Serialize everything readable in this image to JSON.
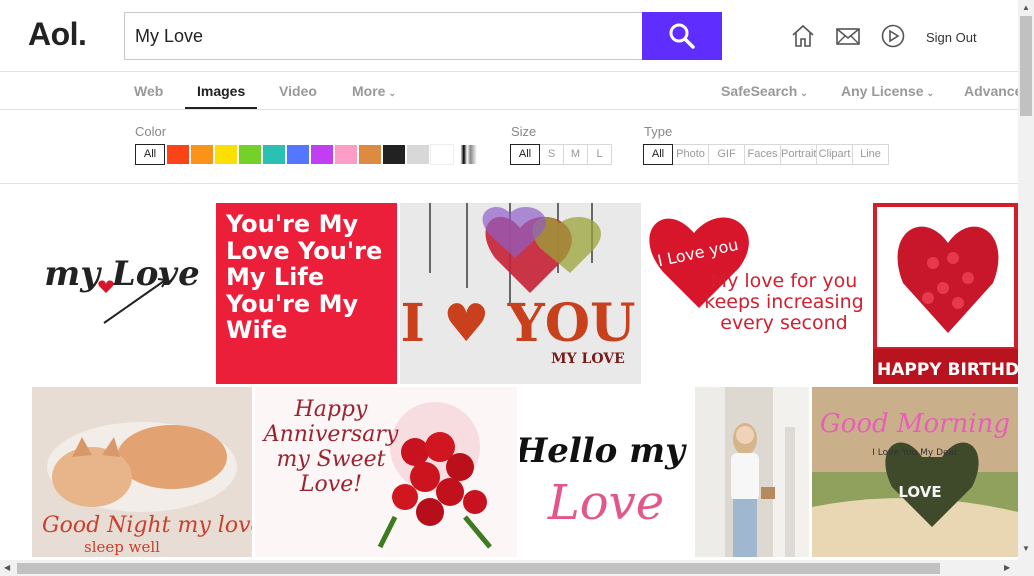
{
  "header": {
    "logo": "Aol.",
    "search_value": "My Love",
    "sign_out": "Sign Out",
    "icons": [
      "home-icon",
      "mail-icon",
      "play-icon"
    ]
  },
  "nav": {
    "tabs": [
      {
        "label": "Web",
        "active": false
      },
      {
        "label": "Images",
        "active": true
      },
      {
        "label": "Video",
        "active": false
      },
      {
        "label": "More",
        "active": false
      }
    ],
    "right": [
      {
        "label": "SafeSearch"
      },
      {
        "label": "Any License"
      },
      {
        "label": "Advanced"
      }
    ]
  },
  "filters": {
    "color_label": "Color",
    "color_all": "All",
    "colors": [
      "#fb4318",
      "#fb9319",
      "#f9e000",
      "#74d12a",
      "#2bc1b2",
      "#5577ff",
      "#c23ef3",
      "#fb9dc4",
      "#dd8b40",
      "#222222",
      "#d8d8d8",
      "#ffffff"
    ],
    "size_label": "Size",
    "sizes": [
      "All",
      "S",
      "M",
      "L"
    ],
    "type_label": "Type",
    "types": [
      "All",
      "Photo",
      "GIF",
      "Faces",
      "Portrait",
      "Clipart",
      "Line"
    ]
  },
  "results": {
    "row1": [
      {
        "text": "my Love",
        "bg": "#ffffff",
        "fg": "#222222"
      },
      {
        "text": "You're My Love You're My Life You're My Wife",
        "bg": "#ec1f3a",
        "fg": "#ffffff"
      },
      {
        "text": "I ♥ YOU",
        "sub": "MY LOVE",
        "bg": "#e9e9e9",
        "fg": "#c8401c"
      },
      {
        "text": "I Love you",
        "sub": "My love for you keeps increasing every second",
        "bg": "#ffffff",
        "fg": "#d1202f"
      },
      {
        "text": "HAPPY BIRTHDAY MY L",
        "bg": "#d21d2b",
        "fg": "#ffffff"
      }
    ],
    "row2": [
      {
        "text": "Good Night my love",
        "sub": "sleep well",
        "bg": "#e7ddd4",
        "fg": "#c9402d"
      },
      {
        "text": "Happy Anniversary my Sweet Love!",
        "bg": "#fdf6f6",
        "fg": "#9a2330"
      },
      {
        "text": "Hello my",
        "sub": "Love",
        "bg": "#ffffff",
        "fg": "#111111"
      },
      {
        "text": "",
        "bg": "#ddd8d0",
        "fg": "#333333"
      },
      {
        "text": "Good Morning",
        "sub": "I Love You My Dear",
        "bg": "#8fa15c",
        "fg": "#e85fb6"
      }
    ]
  }
}
